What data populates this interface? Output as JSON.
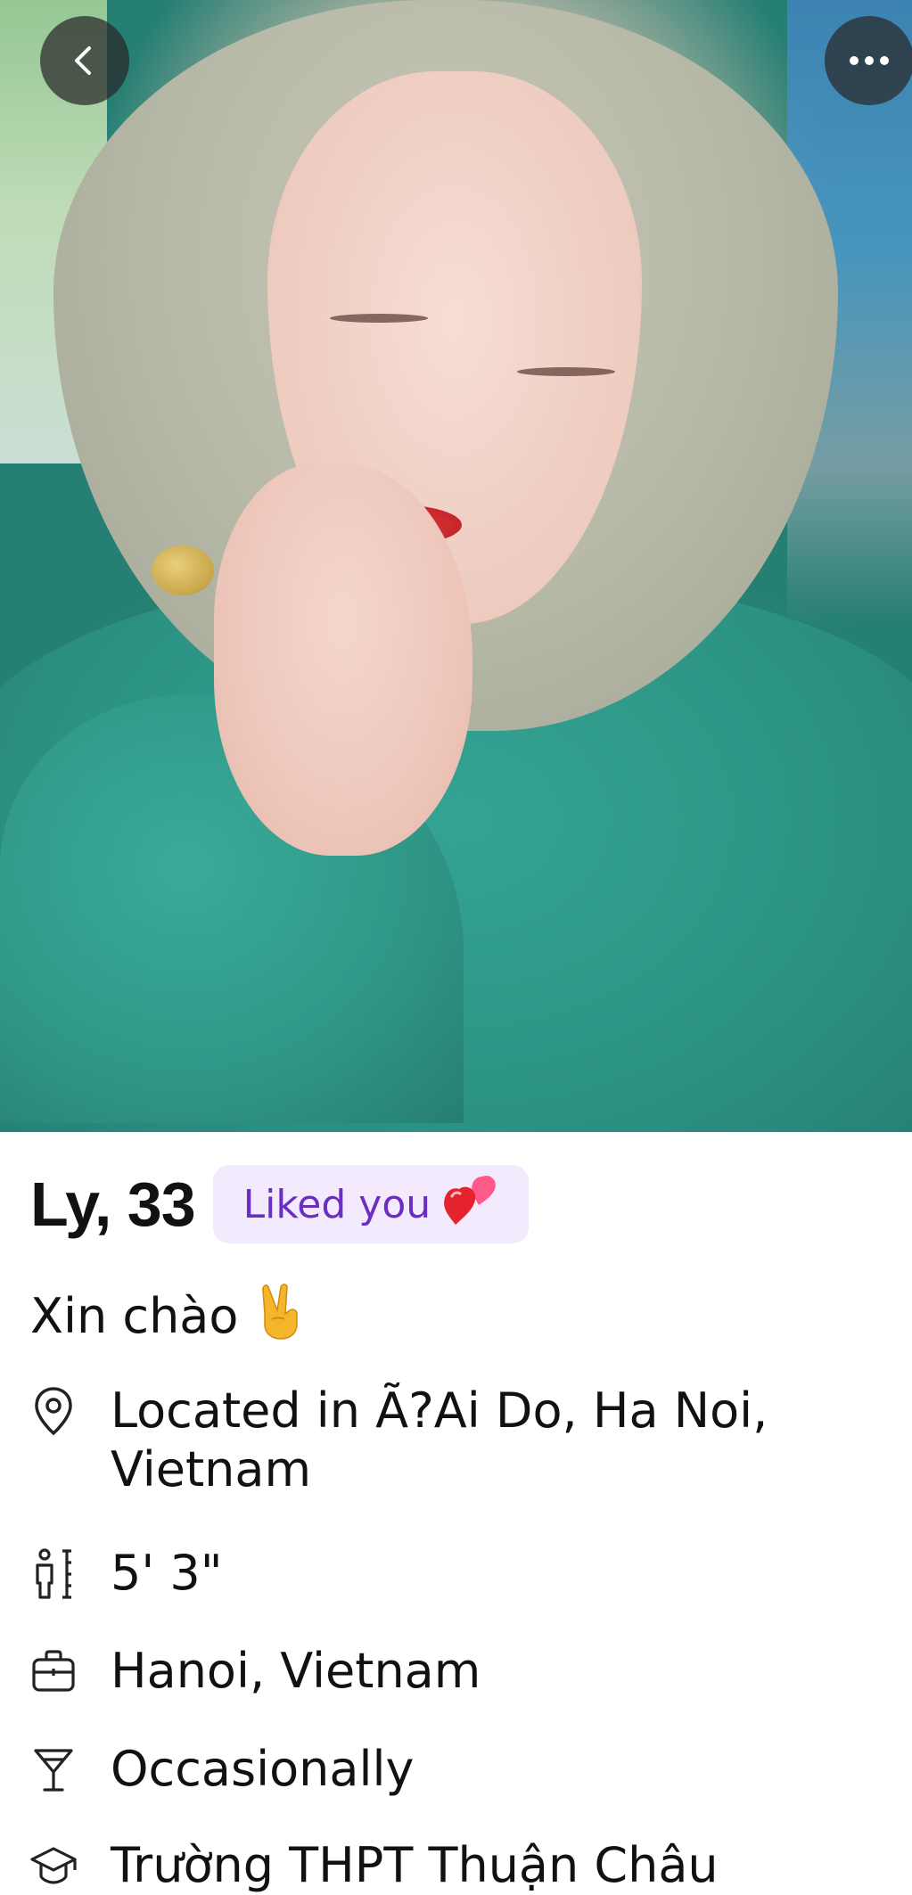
{
  "profile": {
    "name_age": "Ly, 33",
    "liked_badge": "Liked you",
    "greeting": "Xin chào"
  },
  "details": {
    "location": "Located in Ã?Ai Do, Ha Noi, Vietnam",
    "height": "5' 3\"",
    "work": "Hanoi, Vietnam",
    "drinking": "Occasionally",
    "education": "Trường THPT Thuận Châu"
  },
  "colors": {
    "badge_bg": "#f3eafe",
    "badge_text": "#6a2fc1",
    "nav_button_bg": "#282828"
  },
  "icons": {
    "back": "chevron-left-icon",
    "more": "more-horizontal-icon",
    "location": "map-pin-icon",
    "height": "height-icon",
    "work": "briefcase-icon",
    "drinking": "cocktail-glass-icon",
    "education": "graduation-cap-icon"
  }
}
